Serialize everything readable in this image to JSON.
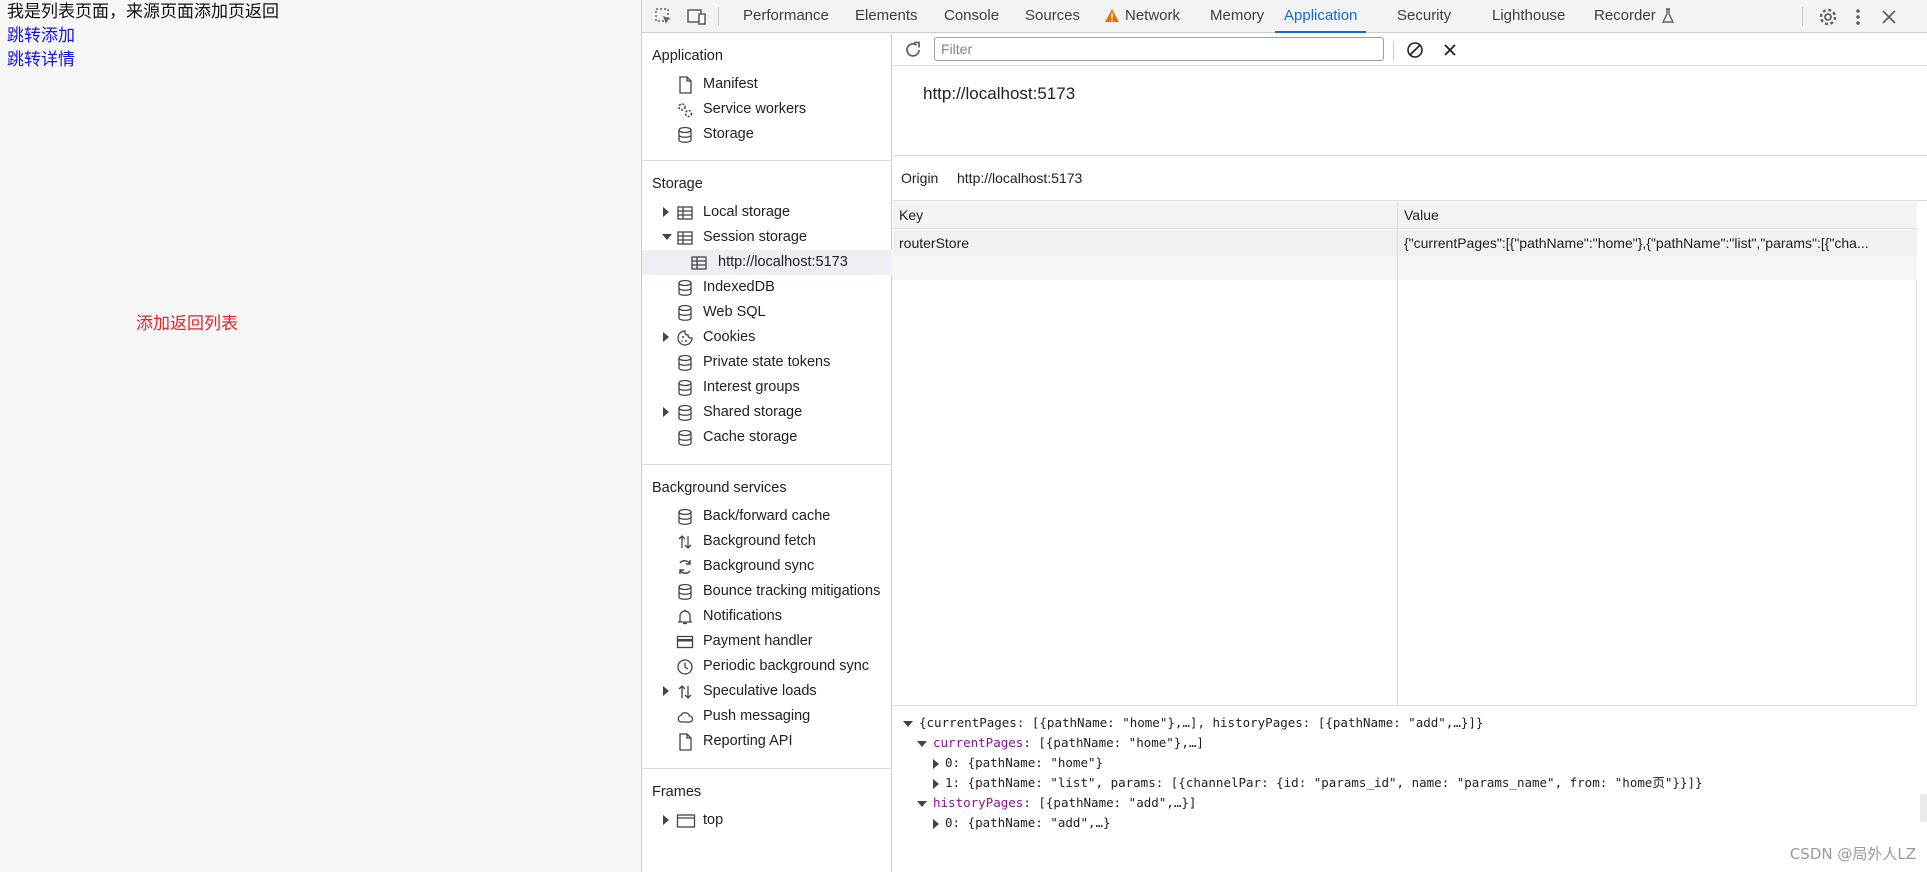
{
  "page": {
    "heading": "我是列表页面，来源页面添加页返回",
    "link_add": "跳转添加",
    "link_detail": "跳转详情",
    "return_note": "添加返回列表"
  },
  "devtools": {
    "tabs": [
      {
        "label": "Performance"
      },
      {
        "label": "Elements"
      },
      {
        "label": "Console"
      },
      {
        "label": "Sources"
      },
      {
        "label": "Network"
      },
      {
        "label": "Memory"
      },
      {
        "label": "Application"
      },
      {
        "label": "Security"
      },
      {
        "label": "Lighthouse"
      },
      {
        "label": "Recorder"
      }
    ],
    "active_tab": "Application",
    "accent": "#1a67d2",
    "sidebar": {
      "application": {
        "title": "Application",
        "items": [
          "Manifest",
          "Service workers",
          "Storage"
        ]
      },
      "storage": {
        "title": "Storage",
        "items": [
          "Local storage",
          "Session storage",
          "http://localhost:5173",
          "IndexedDB",
          "Web SQL",
          "Cookies",
          "Private state tokens",
          "Interest groups",
          "Shared storage",
          "Cache storage"
        ]
      },
      "background": {
        "title": "Background services",
        "items": [
          "Back/forward cache",
          "Background fetch",
          "Background sync",
          "Bounce tracking mitigations",
          "Notifications",
          "Payment handler",
          "Periodic background sync",
          "Speculative loads",
          "Push messaging",
          "Reporting API"
        ]
      },
      "frames": {
        "title": "Frames",
        "items": [
          "top"
        ]
      }
    },
    "main": {
      "filter_placeholder": "Filter",
      "origin_title": "http://localhost:5173",
      "origin_label": "Origin",
      "origin_value": "http://localhost:5173",
      "columns": [
        "Key",
        "Value"
      ],
      "rows": [
        {
          "key": "routerStore",
          "value": "{\"currentPages\":[{\"pathName\":\"home\"},{\"pathName\":\"list\",\"params\":[{\"cha..."
        }
      ],
      "preview": [
        "{currentPages: [{pathName: \"home\"},…], historyPages: [{pathName: \"add\",…}]}",
        "currentPages",
        ": [{pathName: \"home\"},…]",
        "0: {pathName: \"home\"}",
        "1: {pathName: \"list\", params: [{channelPar: {id: \"params_id\", name: \"params_name\", from: \"home页\"}}]}",
        "historyPages",
        ": [{pathName: \"add\",…}]",
        "0: {pathName: \"add\",…}"
      ]
    },
    "watermark": "CSDN @局外人LZ"
  }
}
